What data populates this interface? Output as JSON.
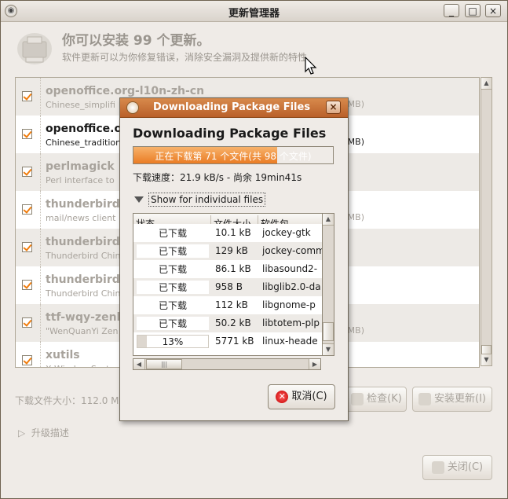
{
  "window": {
    "title": "更新管理器",
    "min": "_",
    "max": "□",
    "close": "×"
  },
  "header": {
    "title": "你可以安装 99 个更新。",
    "subtitle": "软件更新可以为你修复错误，消除安全漏洞及提供新的特性"
  },
  "updates": [
    {
      "name": "openoffice.org-l10n-zh-cn",
      "desc": "Chinese_simplifi",
      "size": "MB)",
      "selected": false
    },
    {
      "name": "openoffice.or",
      "desc": "Chinese_tradition",
      "size": "MB)",
      "selected": true
    },
    {
      "name": "perlmagick",
      "desc": "Perl interface to",
      "size": "",
      "selected": false
    },
    {
      "name": "thunderbird",
      "desc": "mail/news client",
      "size": "0.0 MB)",
      "selected": false
    },
    {
      "name": "thunderbird-l",
      "desc": "Thunderbird Chin",
      "size": "",
      "selected": false
    },
    {
      "name": "thunderbird-l",
      "desc": "Thunderbird Chin",
      "size": "",
      "selected": false
    },
    {
      "name": "ttf-wqy-zenh",
      "desc": "\"WenQuanYi Zen",
      "size": ".0 MB)",
      "selected": false
    },
    {
      "name": "xutils",
      "desc": "X Window System",
      "size": "",
      "selected": false
    }
  ],
  "footer": {
    "download_size": "下载文件大小：112.0 M",
    "check_label": "检查(K)",
    "install_label": "安装更新(I)",
    "upgrade_label": "升级描述",
    "close_label": "关闭(C)"
  },
  "dialog": {
    "title": "Downloading Package Files",
    "heading": "Downloading Package Files",
    "progress_text": "正在下载第 71 个文件(共 98 个文件)",
    "progress_fraction": 0.72,
    "speed": "下载速度：21.9 kB/s - 尚余  19min41s",
    "expander_label": "Show for individual files",
    "columns": [
      "状态",
      "文件大小",
      "软件包"
    ],
    "files": [
      {
        "status": "已下载",
        "size": "10.1 kB",
        "package": "jockey-gtk"
      },
      {
        "status": "已下载",
        "size": "129 kB",
        "package": "jockey-comm"
      },
      {
        "status": "已下载",
        "size": "86.1 kB",
        "package": "libasound2-"
      },
      {
        "status": "已下载",
        "size": "958  B",
        "package": "libglib2.0-da"
      },
      {
        "status": "已下载",
        "size": "112 kB",
        "package": "libgnome-p"
      },
      {
        "status": "已下载",
        "size": "50.2 kB",
        "package": "libtotem-plp"
      },
      {
        "status": "13%",
        "size": "5771 kB",
        "package": "linux-heade",
        "progress": 0.13
      }
    ],
    "cancel_label": "取消(C)",
    "close": "×"
  }
}
